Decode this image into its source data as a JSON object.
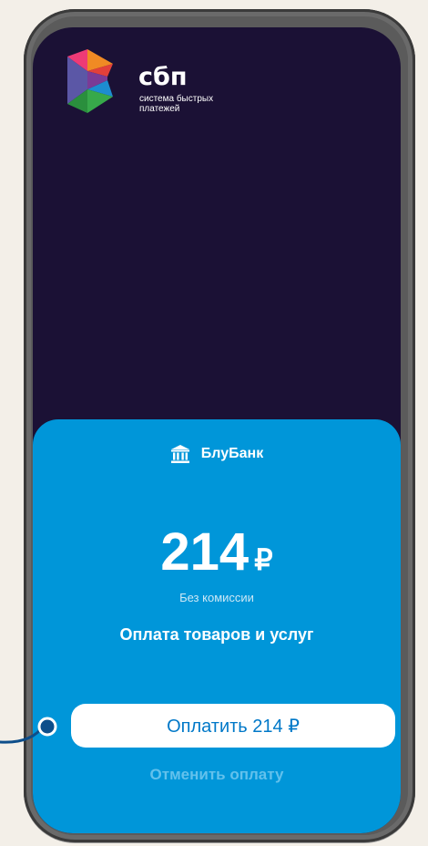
{
  "logo": {
    "name": "сбп",
    "subtitle": "система быстрых платежей"
  },
  "payment": {
    "bank_icon": "bank-icon",
    "bank_name": "БлуБанк",
    "amount": "214",
    "currency": "₽",
    "fee_note": "Без комиссии",
    "purpose": "Оплата товаров и услуг",
    "pay_label": "Оплатить 214 ₽",
    "cancel_label": "Отменить оплату"
  },
  "colors": {
    "screen_bg": "#1b1135",
    "sheet_bg": "#0096d9",
    "pay_text": "#0078c8",
    "cancel_text": "#63c1ec",
    "pointer": "#0d4e8a"
  }
}
